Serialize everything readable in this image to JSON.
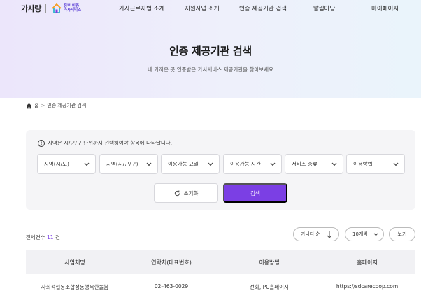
{
  "header": {
    "logo_word": "가사랑",
    "logo_badge_line1": "정부 인증",
    "logo_badge_line2": "가사서비스",
    "nav": [
      {
        "label": "가사근로자법 소개"
      },
      {
        "label": "지원사업 소개"
      },
      {
        "label": "인증 제공기관 검색"
      },
      {
        "label": "알림마당"
      },
      {
        "label": "마이페이지"
      }
    ]
  },
  "hero": {
    "title": "인증 제공기관 검색",
    "subtitle": "내 가까운 곳 인증받은 가사서비스 제공기관을 찾아보세요"
  },
  "breadcrumb": {
    "home": "홈",
    "separator": ">",
    "current": "인증 제공기관 검색"
  },
  "filters": {
    "notice": "지역은 시/군/구 단위까지 선택하여야 항목에 나타납니다.",
    "selects": [
      {
        "label": "지역(시/도)"
      },
      {
        "label": "지역(시/군/구)"
      },
      {
        "label": "이용가능 요일"
      },
      {
        "label": "이용가능 시간"
      },
      {
        "label": "서비스 종류"
      },
      {
        "label": "이용방법"
      }
    ],
    "reset_label": "초기화",
    "search_label": "검색"
  },
  "results": {
    "total_prefix": "전체건수",
    "total_count": "11",
    "total_suffix": "건",
    "sort_label": "가나다 순",
    "per_page_label": "10개씩",
    "view_label": "보기"
  },
  "table": {
    "headers": [
      "사업체명",
      "연락처(대표번호)",
      "이용방법",
      "홈페이지"
    ],
    "rows": [
      [
        "사회적협동조합성동행복한돌봄",
        "02-463-0029",
        "전화, PC홈페이지",
        "https://sdcarecoop.com"
      ]
    ]
  },
  "colors": {
    "accent": "#7b3fe4",
    "hero_start": "#ece6fb",
    "hero_end": "#eaf4fb",
    "panel_bg": "#f5f5f7",
    "table_head_bg": "#f1f1f4"
  }
}
